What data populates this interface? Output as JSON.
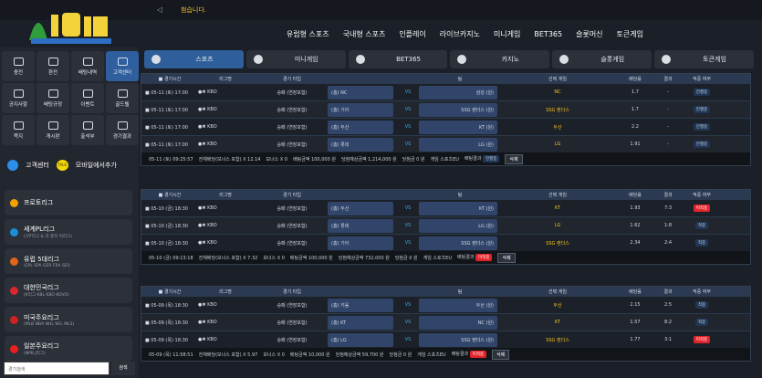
{
  "header": {
    "notice": "첨습니다.",
    "nav": [
      "유럽형 스포츠",
      "국내형 스포츠",
      "인플레이",
      "라이브카지노",
      "미니게임",
      "BET365",
      "슬롯머신",
      "토큰게임"
    ]
  },
  "sidebar": {
    "grid": [
      {
        "label": "충전",
        "icon": "wallet-icon",
        "active": false
      },
      {
        "label": "환전",
        "icon": "dollar-icon",
        "active": false
      },
      {
        "label": "배팅내역",
        "icon": "document-icon",
        "active": false
      },
      {
        "label": "고객센터",
        "icon": "phone-icon",
        "active": true
      },
      {
        "label": "공지사항",
        "icon": "info-icon",
        "active": false
      },
      {
        "label": "배팅규정",
        "icon": "gear-icon",
        "active": false
      },
      {
        "label": "이벤트",
        "icon": "gift-icon",
        "active": false
      },
      {
        "label": "골드텔",
        "icon": "g-icon",
        "active": false
      },
      {
        "label": "쪽지",
        "icon": "mail-icon",
        "active": false
      },
      {
        "label": "게시판",
        "icon": "board-icon",
        "active": false
      },
      {
        "label": "출석부",
        "icon": "calendar-icon",
        "active": false
      },
      {
        "label": "경기결과",
        "icon": "trophy-icon",
        "active": false
      }
    ],
    "telegram": "고객센터",
    "kakao": "모바일에서추가",
    "leagues": [
      {
        "title": "프로토리그",
        "sub": "",
        "color": "#f2a100"
      },
      {
        "title": "세계PL리그",
        "sub": "(1부리그 & 각 종목 빅리그)",
        "color": "#1a8fd8"
      },
      {
        "title": "유럽 5대리그",
        "sub": "(EPL SPA GER FRA SEI)",
        "color": "#e0651a"
      },
      {
        "title": "대한민국리그",
        "sub": "(K리그 KBL KBO KOVO)",
        "color": "#d8272e"
      },
      {
        "title": "미국주요리그",
        "sub": "(MLB NBA NHL NFL MLS)",
        "color": "#c22"
      },
      {
        "title": "일본주요리그",
        "sub": "(NPB J리그)",
        "color": "#e82020"
      }
    ],
    "search_placeholder": "경기검색",
    "search_button": "검색"
  },
  "tabs": [
    "스포츠",
    "미니게임",
    "BET365",
    "카지노",
    "슬롯게임",
    "토큰게임"
  ],
  "columns": [
    "경기시간",
    "리그명",
    "경기 타입",
    "팀",
    "선택 게임",
    "배당률",
    "결과",
    "적중 여부"
  ],
  "panels": [
    {
      "rows": [
        {
          "time": "05-11 (토) 17:00",
          "league": "KBO",
          "type": "승패 (연장포함)",
          "home": "(홈) NC",
          "away": "삼성 (원)",
          "pick": "NC",
          "odds": "1.7",
          "result": "-",
          "status": "진행중"
        },
        {
          "time": "05-11 (토) 17:00",
          "league": "KBO",
          "type": "승패 (연장포함)",
          "home": "(홈) 기아",
          "away": "SSG 랜더스 (원)",
          "pick": "SSG 랜더스",
          "odds": "1.7",
          "result": "-",
          "status": "진행중"
        },
        {
          "time": "05-11 (토) 17:00",
          "league": "KBO",
          "type": "승패 (연장포함)",
          "home": "(홈) 두산",
          "away": "KT (원)",
          "pick": "두산",
          "odds": "2.2",
          "result": "-",
          "status": "진행중"
        },
        {
          "time": "05-11 (토) 17:00",
          "league": "KBO",
          "type": "승패 (연장포함)",
          "home": "(홈) 롯데",
          "away": "LG (원)",
          "pick": "LG",
          "odds": "1.91",
          "result": "-",
          "status": "진행중"
        }
      ],
      "footer": {
        "date": "05-11 (토) 09:25:57",
        "total": "전체배당(보너스 포함) X 12.14",
        "bonus": "보너스 X 0",
        "bet": "배팅금액 100,000 원",
        "win": "당첨예상금액 1,214,000 원",
        "won": "당첨금 0 원",
        "game": "게임 스포츠EU",
        "betres": "배팅결과",
        "betres_badge": "진행중",
        "delete": "삭제"
      }
    },
    {
      "rows": [
        {
          "time": "05-10 (금) 18:30",
          "league": "KBO",
          "type": "승패 (연장포함)",
          "home": "(홈) 두산",
          "away": "KT (원)",
          "pick": "KT",
          "odds": "1.93",
          "result": "7:3",
          "status": "미적중"
        },
        {
          "time": "05-10 (금) 18:30",
          "league": "KBO",
          "type": "승패 (연장포함)",
          "home": "(홈) 롯데",
          "away": "LG (원)",
          "pick": "LG",
          "odds": "1.62",
          "result": "1:8",
          "status": "적중"
        },
        {
          "time": "05-10 (금) 18:30",
          "league": "KBO",
          "type": "승패 (연장포함)",
          "home": "(홈) 기아",
          "away": "SSG 랜더스 (원)",
          "pick": "SSG 랜더스",
          "odds": "2.34",
          "result": "2:4",
          "status": "적중"
        }
      ],
      "footer": {
        "date": "05-10 (금) 09:13:18",
        "total": "전체배당(보너스 포함) X 7.32",
        "bonus": "보너스 X 0",
        "bet": "배팅금액 100,000 원",
        "win": "당첨예상금액 732,000 원",
        "won": "당첨금 0 원",
        "game": "게임 스포츠EU",
        "betres": "배팅결과",
        "betres_badge": "미적중",
        "delete": "삭제"
      }
    },
    {
      "rows": [
        {
          "time": "05-09 (목) 18:30",
          "league": "KBO",
          "type": "승패 (연장포함)",
          "home": "(홈) 키움",
          "away": "두산 (원)",
          "pick": "두산",
          "odds": "2.15",
          "result": "2:5",
          "status": "적중"
        },
        {
          "time": "05-09 (목) 18:30",
          "league": "KBO",
          "type": "승패 (연장포함)",
          "home": "(홈) KT",
          "away": "NC (원)",
          "pick": "KT",
          "odds": "1.57",
          "result": "8:2",
          "status": "적중"
        },
        {
          "time": "05-09 (목) 18:30",
          "league": "KBO",
          "type": "승패 (연장포함)",
          "home": "(홈) LG",
          "away": "SSG 랜더스 (원)",
          "pick": "SSG 랜더스",
          "odds": "1.77",
          "result": "3:1",
          "status": "미적중"
        }
      ],
      "footer": {
        "date": "05-09 (목) 11:58:51",
        "total": "전체배당(보너스 포함) X 5.97",
        "bonus": "보너스 X 0",
        "bet": "배팅금액 10,000 원",
        "win": "당첨예상금액 59,700 원",
        "won": "당첨금 0 원",
        "game": "게임 스포츠EU",
        "betres": "배팅결과",
        "betres_badge": "미적중",
        "delete": "삭제"
      }
    }
  ]
}
